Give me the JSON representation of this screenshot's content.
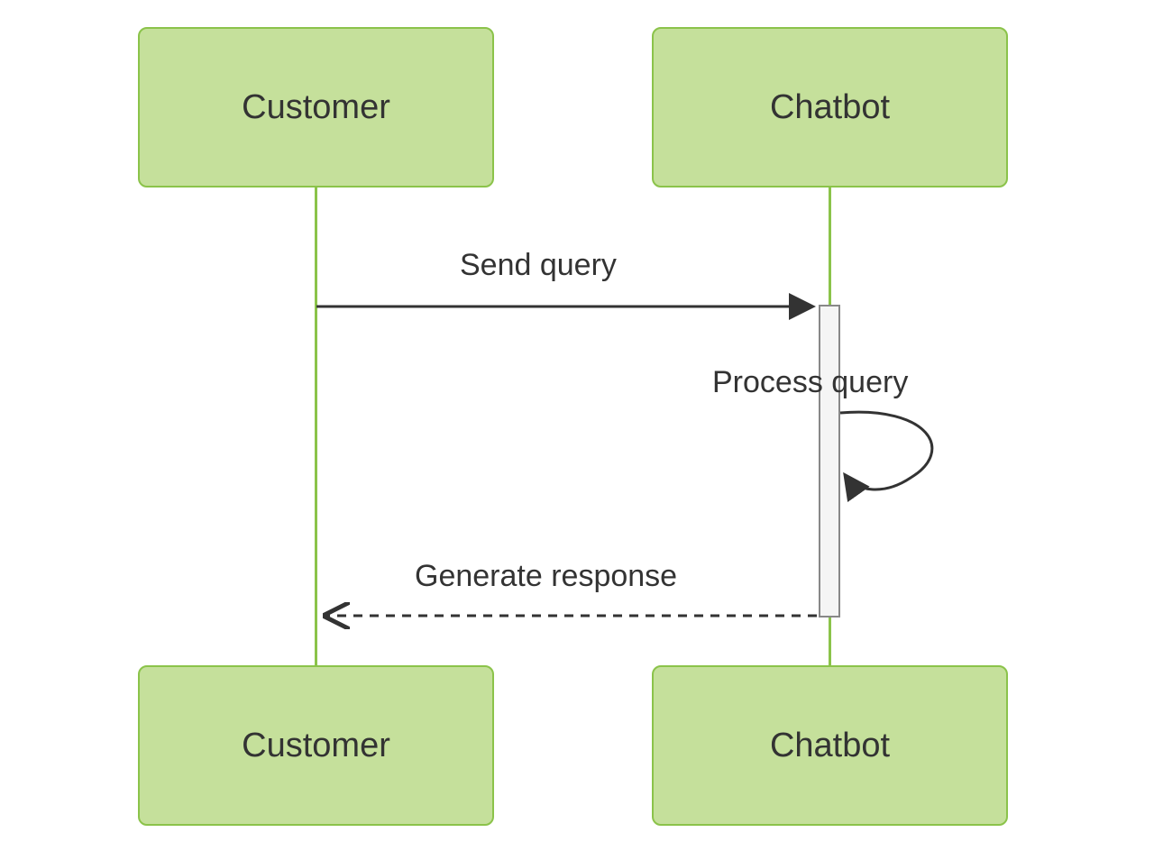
{
  "diagram": {
    "type": "sequence",
    "participants": {
      "left": {
        "top_label": "Customer",
        "bottom_label": "Customer"
      },
      "right": {
        "top_label": "Chatbot",
        "bottom_label": "Chatbot"
      }
    },
    "messages": {
      "m1": {
        "label": "Send query",
        "from": "Customer",
        "to": "Chatbot",
        "style": "solid"
      },
      "m2": {
        "label": "Process query",
        "from": "Chatbot",
        "to": "Chatbot",
        "style": "self"
      },
      "m3": {
        "label": "Generate response",
        "from": "Chatbot",
        "to": "Customer",
        "style": "dashed"
      }
    }
  }
}
